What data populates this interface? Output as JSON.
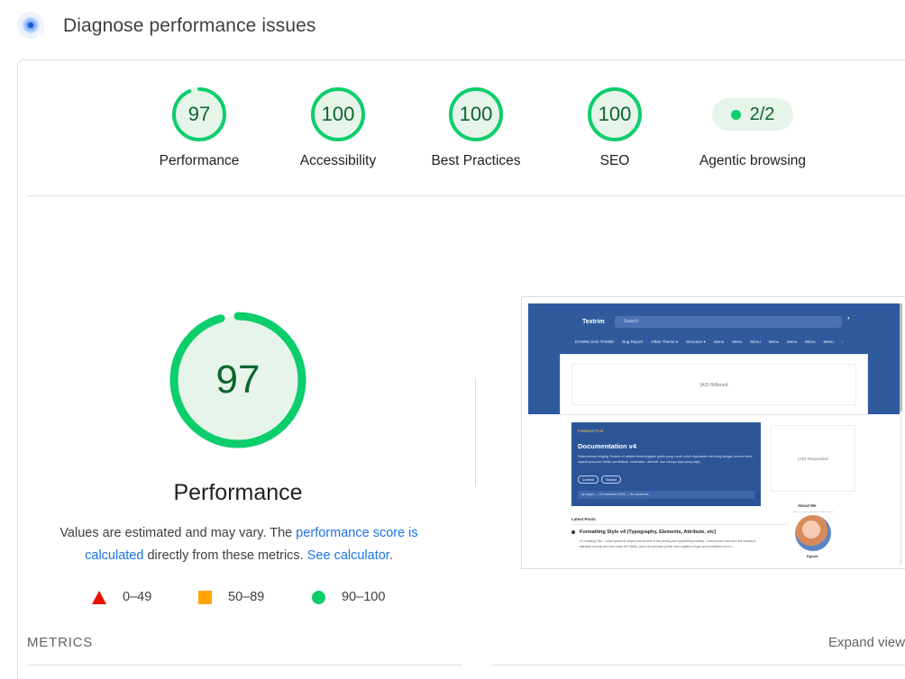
{
  "header": {
    "title": "Diagnose performance issues",
    "icon": "lighthouse-icon"
  },
  "categories": [
    {
      "score": "97",
      "label": "Performance",
      "fraction": 0.97
    },
    {
      "score": "100",
      "label": "Accessibility",
      "fraction": 1.0
    },
    {
      "score": "100",
      "label": "Best Practices",
      "fraction": 1.0
    },
    {
      "score": "100",
      "label": "SEO",
      "fraction": 1.0
    }
  ],
  "agentic": {
    "score": "2/2",
    "label": "Agentic browsing"
  },
  "main": {
    "score": "97",
    "fraction": 0.97,
    "title": "Performance",
    "desc_before": "Values are estimated and may vary. The ",
    "desc_link1": "performance score is calculated",
    "desc_middle": " directly from these metrics. ",
    "desc_link2": "See calculator",
    "desc_after": "."
  },
  "legend": [
    {
      "range": "0–49",
      "shape": "triangle",
      "color": "#eb0f00"
    },
    {
      "range": "50–89",
      "shape": "square",
      "color": "#ffa400"
    },
    {
      "range": "90–100",
      "shape": "circle",
      "color": "#0cce6b"
    }
  ],
  "thumbnail": {
    "site_name": "Textrim",
    "search_placeholder": "Search",
    "nav": [
      "DOWNLOAD THEME",
      "Bug Report",
      "Other Theme ▾",
      "Structure ▾",
      "Menu",
      "Menu",
      "Menu",
      "Menu",
      "Menu",
      "Menu",
      "Menu",
      "›"
    ],
    "ad_billboard": "(AD) Billboard",
    "featured_tag": "Featured Post",
    "featured_title": "Documentation v4",
    "featured_text": "Dokumentasi lengkap Textrim v4 adalah tema blogspot gratis yang cocok untuk digunakan oleh blog dengan semua niche seperti personal, berita, pendidikan, kesehatan, otomotif, dan lainnya (apa yang saja).",
    "btn1": "Content",
    "btn2": "Tutorial",
    "meta": "by Egnari  —  10 Desember 2023  —  No comments",
    "ad_responsive": "(AD) Responsive",
    "about": "About Me",
    "name": "Egnari",
    "latest": "Latest Posts",
    "post_title": "Formatting Style v4 (Typography, Elements, Attribute, etc)",
    "post_text": "H1 Heading Title : Lorem Ipsum is simply dummy text of the printing and typesetting industry. Lorem Ipsum has been the industry's standard dummy text ever since the 1500s, when an unknown printer took a galley of type and scrambled it to m..."
  },
  "metrics": {
    "heading": "METRICS",
    "expand": "Expand view"
  },
  "colors": {
    "pass": "#0cce6b",
    "pass_text": "#0d652d",
    "pass_bg": "#e6f4ea",
    "link": "#1a73e8"
  }
}
